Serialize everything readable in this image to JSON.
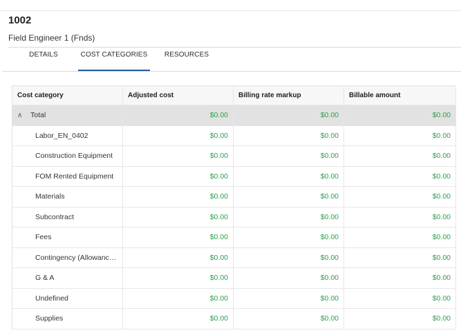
{
  "record": {
    "id": "1002",
    "name": "Field Engineer 1 (Fnds)"
  },
  "tabs": [
    {
      "label": "DETAILS",
      "active": false
    },
    {
      "label": "COST CATEGORIES",
      "active": true
    },
    {
      "label": "RESOURCES",
      "active": false
    }
  ],
  "colors": {
    "accent": "#1e5aa8",
    "money": "#2e9e4c"
  },
  "grid": {
    "columns": [
      "Cost category",
      "Adjusted cost",
      "Billing rate markup",
      "Billable amount"
    ],
    "total": {
      "label": "Total",
      "icon": "chevron-up-icon",
      "adjusted": "$0.00",
      "markup": "$0.00",
      "billable": "$0.00"
    },
    "rows": [
      {
        "category": "Labor_EN_0402",
        "adjusted": "$0.00",
        "markup": "$0.00",
        "billable": "$0.00"
      },
      {
        "category": "Construction Equipment",
        "adjusted": "$0.00",
        "markup": "$0.00",
        "billable": "$0.00"
      },
      {
        "category": "FOM Rented Equipment",
        "adjusted": "$0.00",
        "markup": "$0.00",
        "billable": "$0.00"
      },
      {
        "category": "Materials",
        "adjusted": "$0.00",
        "markup": "$0.00",
        "billable": "$0.00"
      },
      {
        "category": "Subcontract",
        "adjusted": "$0.00",
        "markup": "$0.00",
        "billable": "$0.00"
      },
      {
        "category": "Fees",
        "adjusted": "$0.00",
        "markup": "$0.00",
        "billable": "$0.00"
      },
      {
        "category": "Contingency (Allowance...",
        "adjusted": "$0.00",
        "markup": "$0.00",
        "billable": "$0.00"
      },
      {
        "category": "G & A",
        "adjusted": "$0.00",
        "markup": "$0.00",
        "billable": "$0.00"
      },
      {
        "category": "Undefined",
        "adjusted": "$0.00",
        "markup": "$0.00",
        "billable": "$0.00"
      },
      {
        "category": "Supplies",
        "adjusted": "$0.00",
        "markup": "$0.00",
        "billable": "$0.00"
      }
    ]
  }
}
